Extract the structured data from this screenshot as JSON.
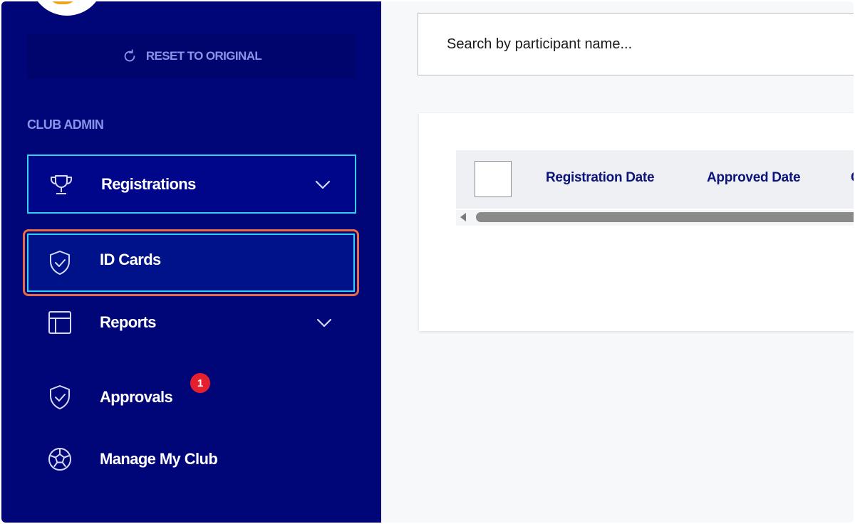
{
  "sidebar": {
    "reset_label": "RESET TO ORIGINAL",
    "section_title": "CLUB ADMIN",
    "items": [
      {
        "label": "Registrations",
        "icon": "trophy-icon",
        "expandable": true
      },
      {
        "label": "ID Cards",
        "icon": "shield-check-icon",
        "active": true
      },
      {
        "label": "Reports",
        "icon": "layout-icon",
        "expandable": true
      },
      {
        "label": "Approvals",
        "icon": "shield-check-icon",
        "badge": "1"
      },
      {
        "label": "Manage My Club",
        "icon": "soccer-ball-icon"
      }
    ]
  },
  "main": {
    "search_placeholder": "Search by participant name...",
    "table": {
      "columns": [
        "Registration Date",
        "Approved Date",
        "C"
      ]
    }
  },
  "colors": {
    "sidebar_bg": "#000577",
    "accent_border": "#2fd0f2",
    "highlight_outline": "#ea6a45",
    "badge": "#e5202e",
    "header_text": "#0c147a"
  }
}
